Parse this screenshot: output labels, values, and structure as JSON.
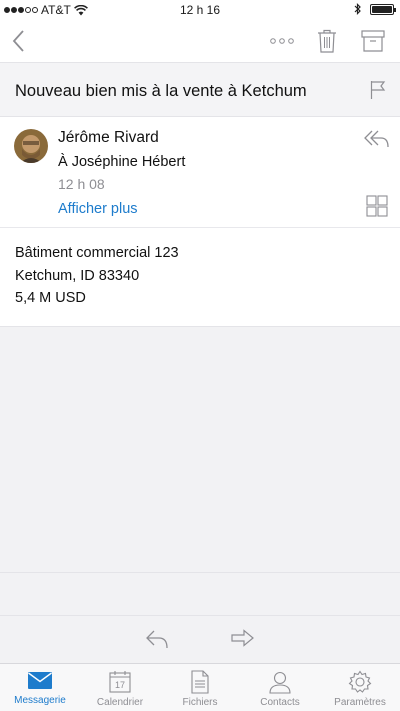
{
  "status_bar": {
    "carrier": "AT&T",
    "time": "12 h 16"
  },
  "toolbar": {
    "back_icon": "chevron-left-icon",
    "more_icon": "more-icon",
    "delete_icon": "trash-icon",
    "archive_icon": "archive-icon"
  },
  "message": {
    "subject": "Nouveau bien mis à la vente à Ketchum",
    "sender": "Jérôme Rivard",
    "recipient": "À Joséphine Hébert",
    "time": "12 h 08",
    "show_more": "Afficher plus",
    "body": {
      "line1": "Bâtiment commercial 123",
      "line2": "Ketchum, ID 83340",
      "line3": "5,4 M USD"
    }
  },
  "tabbar": {
    "tabs": [
      {
        "label": "Messagerie",
        "icon": "mail-icon",
        "active": true
      },
      {
        "label": "Calendrier",
        "icon": "calendar-icon",
        "day": "17"
      },
      {
        "label": "Fichiers",
        "icon": "file-icon"
      },
      {
        "label": "Contacts",
        "icon": "person-icon"
      },
      {
        "label": "Paramètres",
        "icon": "gear-icon"
      }
    ]
  },
  "colors": {
    "accent": "#1e7ccc",
    "icon_gray": "#8e8e93"
  }
}
